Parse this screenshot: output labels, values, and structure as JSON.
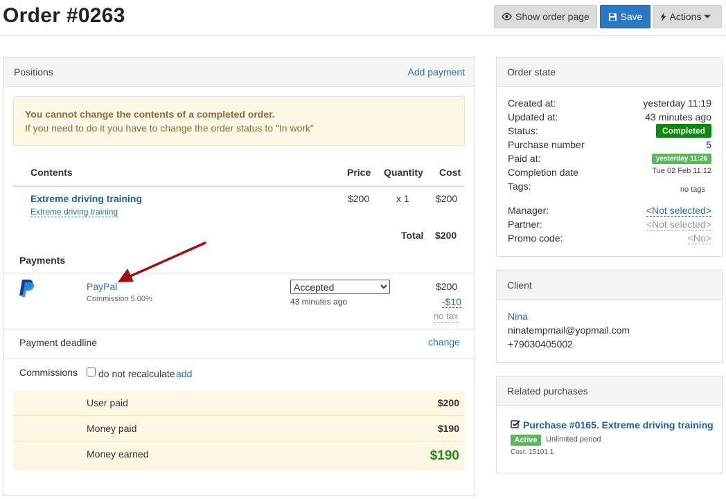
{
  "header": {
    "title": "Order #0263",
    "show_order_page": "Show order page",
    "save": "Save",
    "actions": "Actions"
  },
  "positions": {
    "title": "Positions",
    "add_payment": "Add payment",
    "alert_title": "You cannot change the contents of a completed order.",
    "alert_text": "If you need to do it you have to change the order status to \"In work\"",
    "columns": {
      "contents": "Contents",
      "price": "Price",
      "quantity": "Quantity",
      "cost": "Cost"
    },
    "item": {
      "name": "Extreme driving training",
      "sub": "Extreme driving training",
      "price": "$200",
      "quantity": "x 1",
      "cost": "$200"
    },
    "total_label": "Total",
    "total_value": "$200"
  },
  "payments": {
    "title": "Payments",
    "method": "PayPal",
    "commission": "Commission 5.00%",
    "status": "Accepted",
    "status_options": [
      "Accepted"
    ],
    "time": "43 minutes ago",
    "amount": "$200",
    "fee": "-$10",
    "tax": "no tax",
    "deadline_label": "Payment deadline",
    "deadline_action": "change",
    "commissions_label": "Commissions",
    "no_recalc": "do not recalculate",
    "add": "add",
    "user_paid_label": "User paid",
    "user_paid": "$200",
    "money_paid_label": "Money paid",
    "money_paid": "$190",
    "money_earned_label": "Money earned",
    "money_earned": "$190"
  },
  "order_state": {
    "title": "Order state",
    "created_label": "Created at:",
    "created": "yesterday 11:19",
    "updated_label": "Updated at:",
    "updated": "43 minutes ago",
    "status_label": "Status:",
    "status": "Completed",
    "purchase_label": "Purchase number",
    "purchase": "5",
    "paid_label": "Paid at:",
    "paid": "yesterday 11:26",
    "completion_label": "Completion date",
    "completion": "Tue 02 Feb 11:12",
    "tags_label": "Tags:",
    "tags": "no tags",
    "manager_label": "Manager:",
    "manager": "<Not selected>",
    "partner_label": "Partner:",
    "partner": "<Not selected>",
    "promo_label": "Promo code:",
    "promo": "<No>"
  },
  "client": {
    "title": "Client",
    "name": "Nina",
    "email": "ninatempmail@yopmail.com",
    "phone": "+79030405002"
  },
  "related": {
    "title": "Related purchases",
    "purchase": "Purchase #0165. Extreme driving training",
    "badge": "Active",
    "period": "Unlimited period",
    "cost": "Cost: 15101.1"
  },
  "colors": {
    "accent": "#2a78c2",
    "completed": "#0a8a0a",
    "paid_badge": "#5cb85c",
    "earned": "#1e8a1e",
    "arrow": "#a01010"
  }
}
